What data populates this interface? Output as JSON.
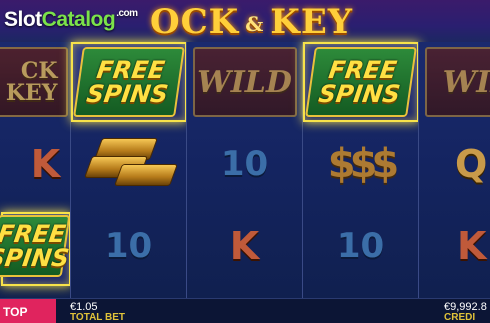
{
  "watermark": {
    "part1": "Slot",
    "part2": "Catalog",
    "suffix": ".com"
  },
  "game": {
    "title_left": "OCK",
    "title_amp": "&",
    "title_right": "KEY"
  },
  "reels": {
    "r0": {
      "top_line1": "CK",
      "top_line2": "KEY",
      "mid": "K",
      "bottom_line1": "FREE",
      "bottom_line2": "SPINS"
    },
    "r1": {
      "top_line1": "FREE",
      "top_line2": "SPINS",
      "bottom": "10"
    },
    "r2": {
      "top": "WILD",
      "mid": "10",
      "bottom": "K"
    },
    "r3": {
      "top_line1": "FREE",
      "top_line2": "SPINS",
      "mid": "$$$",
      "bottom": "10"
    },
    "r4": {
      "top": "WIL",
      "mid": "Q",
      "bottom": "K"
    }
  },
  "bottom_bar": {
    "stop_label": "TOP",
    "bet_value": "€1.05",
    "bet_label": "TOTAL BET",
    "credit_value": "€9,992.8",
    "credit_label": "CREDI"
  },
  "colors": {
    "highlight": "#f7e24a",
    "stop_button": "#e0245e",
    "label_gold": "#e0c23a"
  }
}
